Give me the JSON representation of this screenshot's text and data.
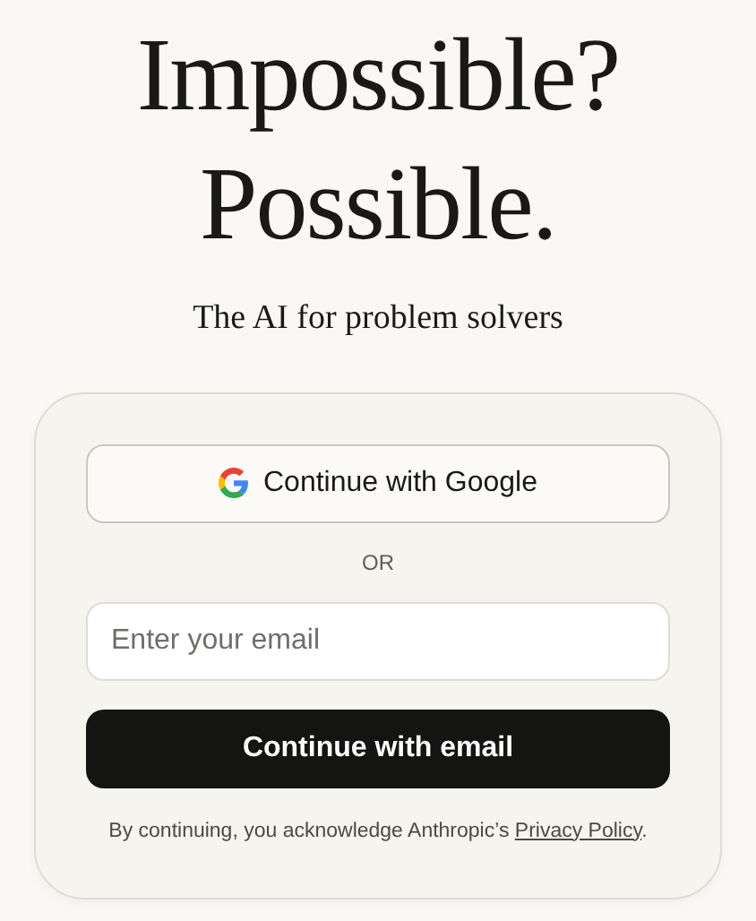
{
  "headline": [
    "Impossible?",
    "Possible."
  ],
  "tagline": "The AI for problem solvers",
  "login": {
    "google_button": "Continue with Google",
    "divider": "OR",
    "email": {
      "placeholder": "Enter your email"
    },
    "email_button": "Continue with email",
    "legal": {
      "text": "By continuing, you acknowledge Anthropic’s",
      "link": "Privacy Policy",
      "end": "."
    }
  }
}
